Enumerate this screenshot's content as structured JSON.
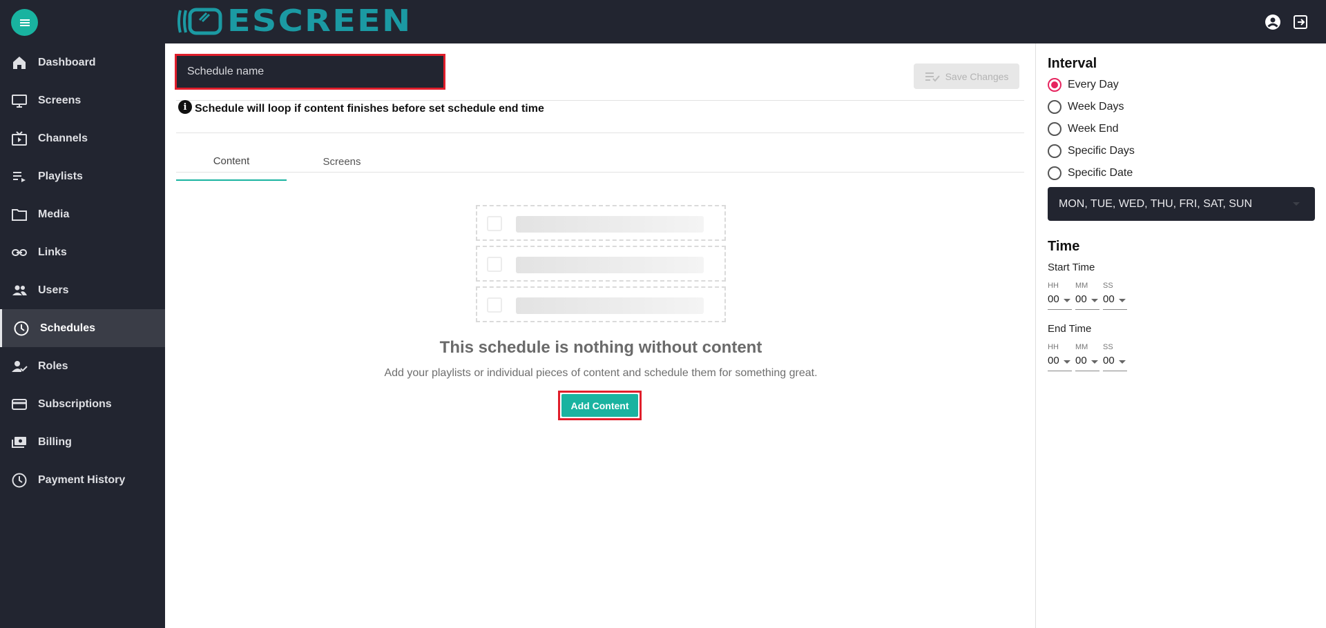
{
  "app": {
    "logo_text": "ESCREEN"
  },
  "header": {
    "menu_icon": "hamburger-icon",
    "account_icon": "account-circle-icon",
    "logout_icon": "logout-icon"
  },
  "sidebar": {
    "items": [
      {
        "label": "Dashboard",
        "icon": "home-icon"
      },
      {
        "label": "Screens",
        "icon": "monitor-icon"
      },
      {
        "label": "Channels",
        "icon": "tv-play-icon"
      },
      {
        "label": "Playlists",
        "icon": "playlist-icon"
      },
      {
        "label": "Media",
        "icon": "folder-icon"
      },
      {
        "label": "Links",
        "icon": "link-icon"
      },
      {
        "label": "Users",
        "icon": "users-icon"
      },
      {
        "label": "Schedules",
        "icon": "clock-icon",
        "active": true
      },
      {
        "label": "Roles",
        "icon": "user-check-icon"
      },
      {
        "label": "Subscriptions",
        "icon": "credit-card-icon"
      },
      {
        "label": "Billing",
        "icon": "billing-icon"
      },
      {
        "label": "Payment History",
        "icon": "history-icon"
      }
    ]
  },
  "main": {
    "name_placeholder": "Schedule name",
    "save_label": "Save Changes",
    "info_text": "Schedule will loop if content finishes before set schedule end time",
    "tabs": [
      {
        "label": "Content",
        "active": true
      },
      {
        "label": "Screens",
        "active": false
      }
    ],
    "empty": {
      "title": "This schedule is nothing without content",
      "subtitle": "Add your playlists or individual pieces of content and schedule them for something great.",
      "button": "Add Content"
    }
  },
  "right": {
    "interval_title": "Interval",
    "interval_options": [
      {
        "label": "Every Day",
        "checked": true
      },
      {
        "label": "Week Days",
        "checked": false
      },
      {
        "label": "Week End",
        "checked": false
      },
      {
        "label": "Specific Days",
        "checked": false
      },
      {
        "label": "Specific Date",
        "checked": false
      }
    ],
    "days_value": "MON, TUE, WED, THU, FRI, SAT, SUN",
    "time_title": "Time",
    "start_label": "Start Time",
    "end_label": "End Time",
    "units": [
      "HH",
      "MM",
      "SS"
    ],
    "start_values": [
      "00",
      "00",
      "00"
    ],
    "end_values": [
      "00",
      "00",
      "00"
    ]
  },
  "colors": {
    "accent": "#19b3a0",
    "sidebar_bg": "#222530",
    "highlight": "#e01e2b",
    "radio_checked": "#e6245e"
  }
}
